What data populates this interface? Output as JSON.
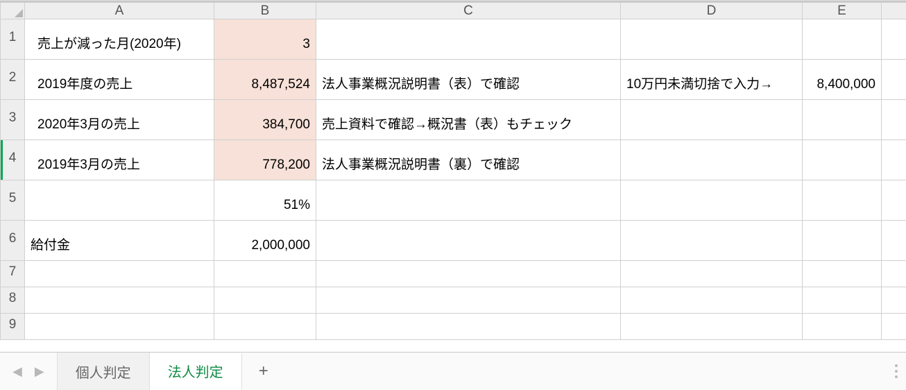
{
  "columns": [
    "A",
    "B",
    "C",
    "D",
    "E"
  ],
  "rows": [
    "1",
    "2",
    "3",
    "4",
    "5",
    "6",
    "7",
    "8",
    "9"
  ],
  "selectedRow": "4",
  "cells": {
    "r1": {
      "A": "売上が減った月(2020年)",
      "B": "3",
      "C": "",
      "D": "",
      "E": ""
    },
    "r2": {
      "A": "2019年度の売上",
      "B": "8,487,524",
      "C": "法人事業概況説明書（表）で確認",
      "D": "10万円未満切捨で入力→",
      "E": "8,400,000"
    },
    "r3": {
      "A": "2020年3月の売上",
      "B": "384,700",
      "C": "売上資料で確認→概況書（表）もチェック",
      "D": "",
      "E": ""
    },
    "r4": {
      "A": "2019年3月の売上",
      "B": "778,200",
      "C": "法人事業概況説明書（裏）で確認",
      "D": "",
      "E": ""
    },
    "r5": {
      "A": "",
      "B": "51%",
      "C": "",
      "D": "",
      "E": ""
    },
    "r6": {
      "A": "給付金",
      "B": "2,000,000",
      "C": "",
      "D": "",
      "E": ""
    },
    "r7": {
      "A": "",
      "B": "",
      "C": "",
      "D": "",
      "E": ""
    },
    "r8": {
      "A": "",
      "B": "",
      "C": "",
      "D": "",
      "E": ""
    },
    "r9": {
      "A": "",
      "B": "",
      "C": "",
      "D": "",
      "E": ""
    }
  },
  "highlight": {
    "col": "B",
    "rows": [
      "1",
      "2",
      "3",
      "4"
    ]
  },
  "tabs": {
    "items": [
      {
        "label": "個人判定",
        "active": false
      },
      {
        "label": "法人判定",
        "active": true
      }
    ],
    "add": "+"
  },
  "nav": {
    "prev": "◀",
    "next": "▶"
  }
}
